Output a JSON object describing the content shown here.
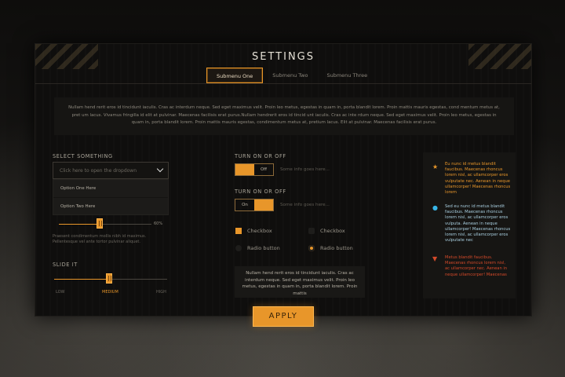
{
  "title": "SETTINGS",
  "tabs": [
    {
      "label": "Submenu One",
      "active": true
    },
    {
      "label": "Submenu Two",
      "active": false
    },
    {
      "label": "Submenu Three",
      "active": false
    }
  ],
  "intro_text": "Nullam hend rerit eros id tincidunt iaculis. Cras ac interdum neque. Sed eget maximus velit. Proin leo metus, egestas in quam in, porta blandit lorem. Proin mattis mauris egestas, cond mentum metus at, pret um lacus. Vivamus fringilla id elit at pulvinar. Maecenas facilisis erat purus.Nullam hendrerit eros id tincid unt iaculis. Cras ac inte rdum neque. Sed eget maximus velit. Proin leo metus, egestas in quam in, porta blandit lorem. Proin mattis mauris egestas, condimentum metus at, pretium lacus. Elit at pulvinar. Maecenas facilisis erat purus.",
  "select": {
    "label": "SELECT SOMETHING",
    "placeholder": "Click here to open the dropdown",
    "options": [
      "Option One Here",
      "Option Two Here"
    ]
  },
  "slider1": {
    "value_text": "60%",
    "value": 0.6,
    "caption": "Praesent condimentum mollis nibh id maximus. Pellentesque vel ante tortor pulvinar aliquet."
  },
  "slide_it": {
    "label": "SLIDE IT",
    "low": "LOW",
    "medium": "MEDIUM",
    "high": "HIGH",
    "value": 0.5
  },
  "toggles": [
    {
      "label": "TURN ON OR OFF",
      "off_text": "Off",
      "on_text": "",
      "state": "off-selected-left",
      "info": "Some info goes here..."
    },
    {
      "label": "TURN ON OR OFF",
      "off_text": "On",
      "on_text": "",
      "state": "on-right",
      "info": "Some info goes here..."
    }
  ],
  "checkboxes": [
    {
      "label": "Checkbox",
      "checked": true
    },
    {
      "label": "Checkbox",
      "checked": false
    }
  ],
  "radios": [
    {
      "label": "Radio button",
      "checked": false
    },
    {
      "label": "Radio button",
      "checked": true
    }
  ],
  "textbox": "Nullam hend rerit eros id tincidunt iaculis. Cras ac interdum neque. Sed eget maximus velit. Proin leo metus, egestas in quam in, porta blandit lorem. Proin mattis",
  "side_items": [
    {
      "icon": "star-icon",
      "color": "#e8962a",
      "text": "Eu nunc id metus blandit faucibus. Maecenas rhoncus lorem nisl, ac ullamcorper eros vulputate nec. Aenean in neque ullamcorper! Maecenas rhoncus lorem"
    },
    {
      "icon": "info-dot-icon",
      "color": "#38b6e8",
      "text": "Sed eu nunc id metus blandit faucibus. Maecenas rhoncus lorem nisl, ac ullamcorper eros vulputa. Aenean in neque ullamcorper! Maecenas rhoncus lorem nisl, ac ullamcorper eros vulputate nec"
    },
    {
      "icon": "warning-icon",
      "color": "#d44a2a",
      "text": "Metus blandit faucibus. Maecenas rhoncus lorem nisl, ac ullamcorper nec. Aenean in neque ullamcorper! Maecenas"
    }
  ],
  "apply_label": "APPLY"
}
